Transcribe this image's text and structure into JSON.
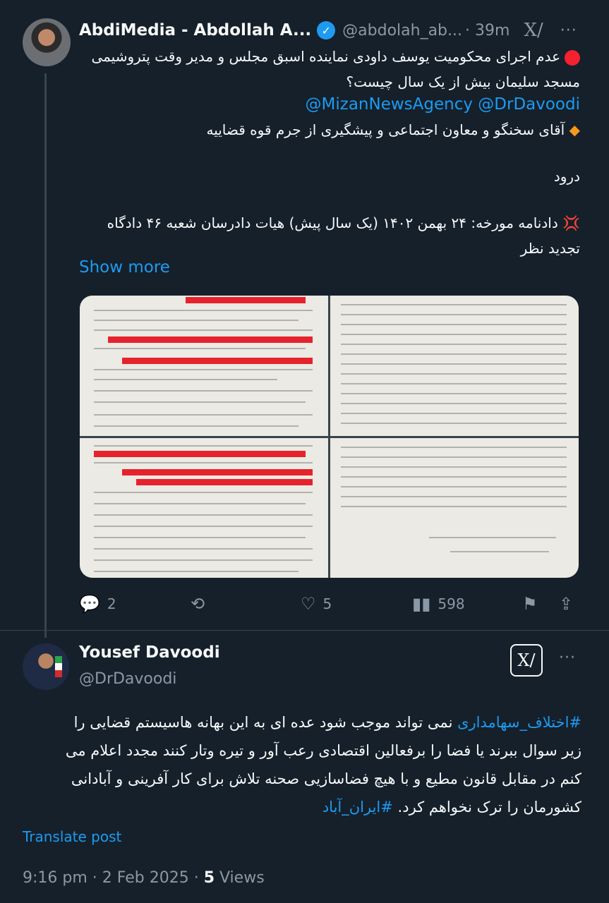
{
  "thread": {
    "author_name": "AbdiMedia - Abdollah A...",
    "author_handle": "@abdolah_ab...",
    "time": "· 39m",
    "lines": [
      "عدم اجرای محکومیت یوسف داودی نماینده اسبق مجلس و مدیر وقت پتروشیمی",
      "مسجد سلیمان بیش از یک سال چیست؟",
      "@MizanNewsAgency @DrDavoodi",
      "آقای سخنگو و معاون اجتماعی و پیشگیری از جرم قوه قضاییه",
      "درود",
      "دادنامه مورخه: ۲۴ بهمن ۱۴۰۲ (یک سال پیش) هیات دادرسان شعبه ۴۶ دادگاه",
      "تجدید نظر"
    ],
    "show_more": "Show more",
    "stats": {
      "replies": "2",
      "likes": "5",
      "views": "598"
    }
  },
  "post": {
    "author_name": "Yousef Davoodi",
    "author_handle": "@DrDavoodi",
    "hashtag1": "#اختلاف_سهامداری",
    "text_line1": " نمی تواند موجب شود عده ای به این بهانه هاسیستم قضایی را",
    "text_line2": "زیر سوال ببرند یا فضا را برفعالین اقتصادی رعب آور و تیره وتار کنند مجدد اعلام می",
    "text_line3": "کنم در مقابل قانون مطیع و با هیچ فضاسازیی صحنه تلاش برای کار آفرینی و آبادانی",
    "text_line4": "کشورمان را ترک نخواهم کرد. ",
    "hashtag2": "#ایران_آباد",
    "translate": "Translate post",
    "timestamp": "9:16 pm · 2 Feb 2025 · ",
    "views_count": "5",
    "views_label": " Views"
  },
  "colors": {
    "background": "#15202b",
    "accent": "#1d9bf0",
    "muted": "#8b98a5",
    "text": "#f7f9f9"
  }
}
